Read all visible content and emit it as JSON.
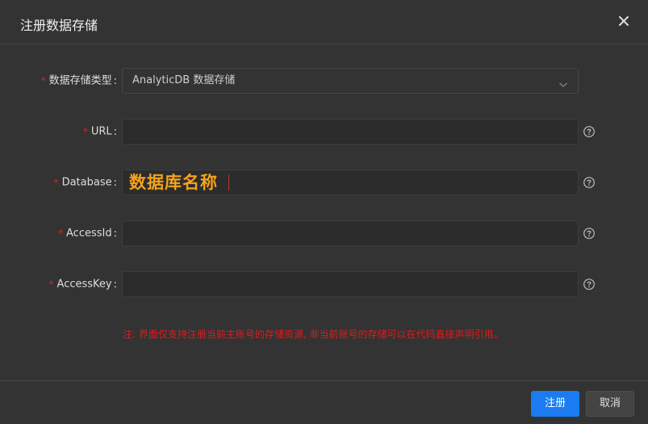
{
  "dialog": {
    "title": "注册数据存储",
    "close_icon": "close-icon"
  },
  "form": {
    "required_mark": "*",
    "colon": ":",
    "store_type": {
      "label": "数据存储类型",
      "value": "AnalyticDB 数据存储"
    },
    "url": {
      "label": "URL",
      "value": ""
    },
    "database": {
      "label": "Database",
      "value": "数据库名称"
    },
    "access_id": {
      "label": "AccessId",
      "value": ""
    },
    "access_key": {
      "label": "AccessKey",
      "value": ""
    }
  },
  "note": "注: 界面仅支持注册当前主账号的存储资源, 非当前账号的存储可以在代码直接声明引用。",
  "footer": {
    "submit_label": "注册",
    "cancel_label": "取消"
  },
  "colors": {
    "primary": "#1a7cf0",
    "required": "#e02020",
    "highlight": "#f3a21b"
  }
}
